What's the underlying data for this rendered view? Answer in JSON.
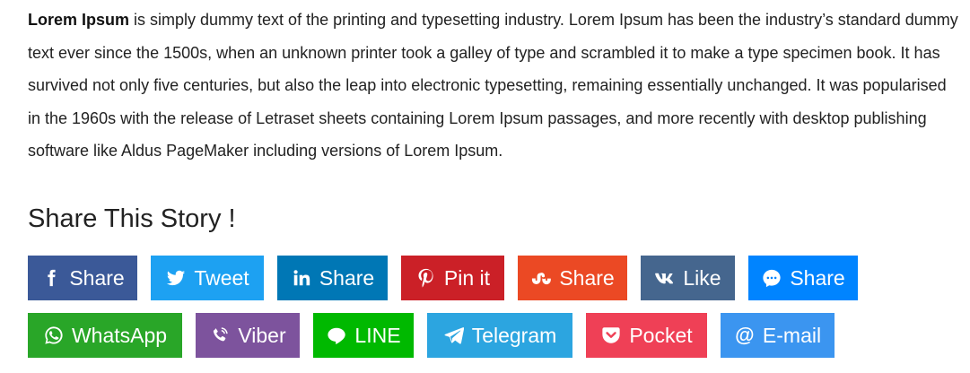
{
  "article": {
    "lead": "Lorem Ipsum",
    "body": " is simply dummy text of the printing and typesetting industry. Lorem Ipsum has been the industry’s standard dummy text ever since the 1500s, when an unknown printer took a galley of type and scrambled it to make a type specimen book. It has survived not only five centuries, but also the leap into electronic typesetting, remaining essentially unchanged. It was popularised in the 1960s with the release of Letraset sheets containing Lorem Ipsum passages, and more recently with desktop publishing software like Aldus PageMaker including versions of Lorem Ipsum."
  },
  "share": {
    "title": "Share This Story !",
    "buttons": [
      {
        "label": "Share",
        "icon": "facebook-icon",
        "color": "#3b5998"
      },
      {
        "label": "Tweet",
        "icon": "twitter-icon",
        "color": "#1da1f2"
      },
      {
        "label": "Share",
        "icon": "linkedin-icon",
        "color": "#0077b5"
      },
      {
        "label": "Pin it",
        "icon": "pinterest-icon",
        "color": "#cb2027"
      },
      {
        "label": "Share",
        "icon": "stumbleupon-icon",
        "color": "#eb4924"
      },
      {
        "label": "Like",
        "icon": "vk-icon",
        "color": "#45668e"
      },
      {
        "label": "Share",
        "icon": "messenger-icon",
        "color": "#0084ff"
      },
      {
        "label": "WhatsApp",
        "icon": "whatsapp-icon",
        "color": "#29a628"
      },
      {
        "label": "Viber",
        "icon": "viber-icon",
        "color": "#7d539d"
      },
      {
        "label": "LINE",
        "icon": "line-icon",
        "color": "#00b900"
      },
      {
        "label": "Telegram",
        "icon": "telegram-icon",
        "color": "#2ca5e0"
      },
      {
        "label": "Pocket",
        "icon": "pocket-icon",
        "color": "#ef4056"
      },
      {
        "label": "E-mail",
        "icon": "email-icon",
        "color": "#3b95f0"
      }
    ]
  }
}
